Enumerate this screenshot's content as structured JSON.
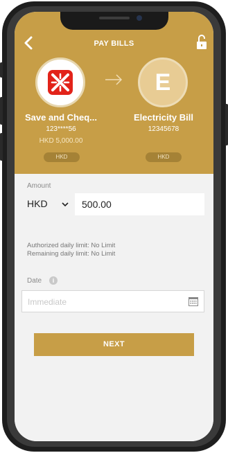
{
  "header": {
    "title": "PAY BILLS",
    "back_icon": "chevron-left-icon",
    "lock_icon": "unlock-icon"
  },
  "from_account": {
    "name": "Save and Cheq...",
    "number": "123****56",
    "balance": "HKD 5,000.00",
    "currency_badge": "HKD"
  },
  "to_payee": {
    "initial": "E",
    "name": "Electricity Bill",
    "number": "12345678",
    "currency_badge": "HKD"
  },
  "amount": {
    "label": "Amount",
    "currency": "HKD",
    "value": "500.00"
  },
  "limits": {
    "authorized": "Authorized daily limit: No Limit",
    "remaining": "Remaining daily limit: No Limit"
  },
  "date": {
    "label": "Date",
    "placeholder": "Immediate"
  },
  "next_label": "NEXT",
  "colors": {
    "accent": "#c79e47",
    "logo_red": "#e2231a"
  }
}
